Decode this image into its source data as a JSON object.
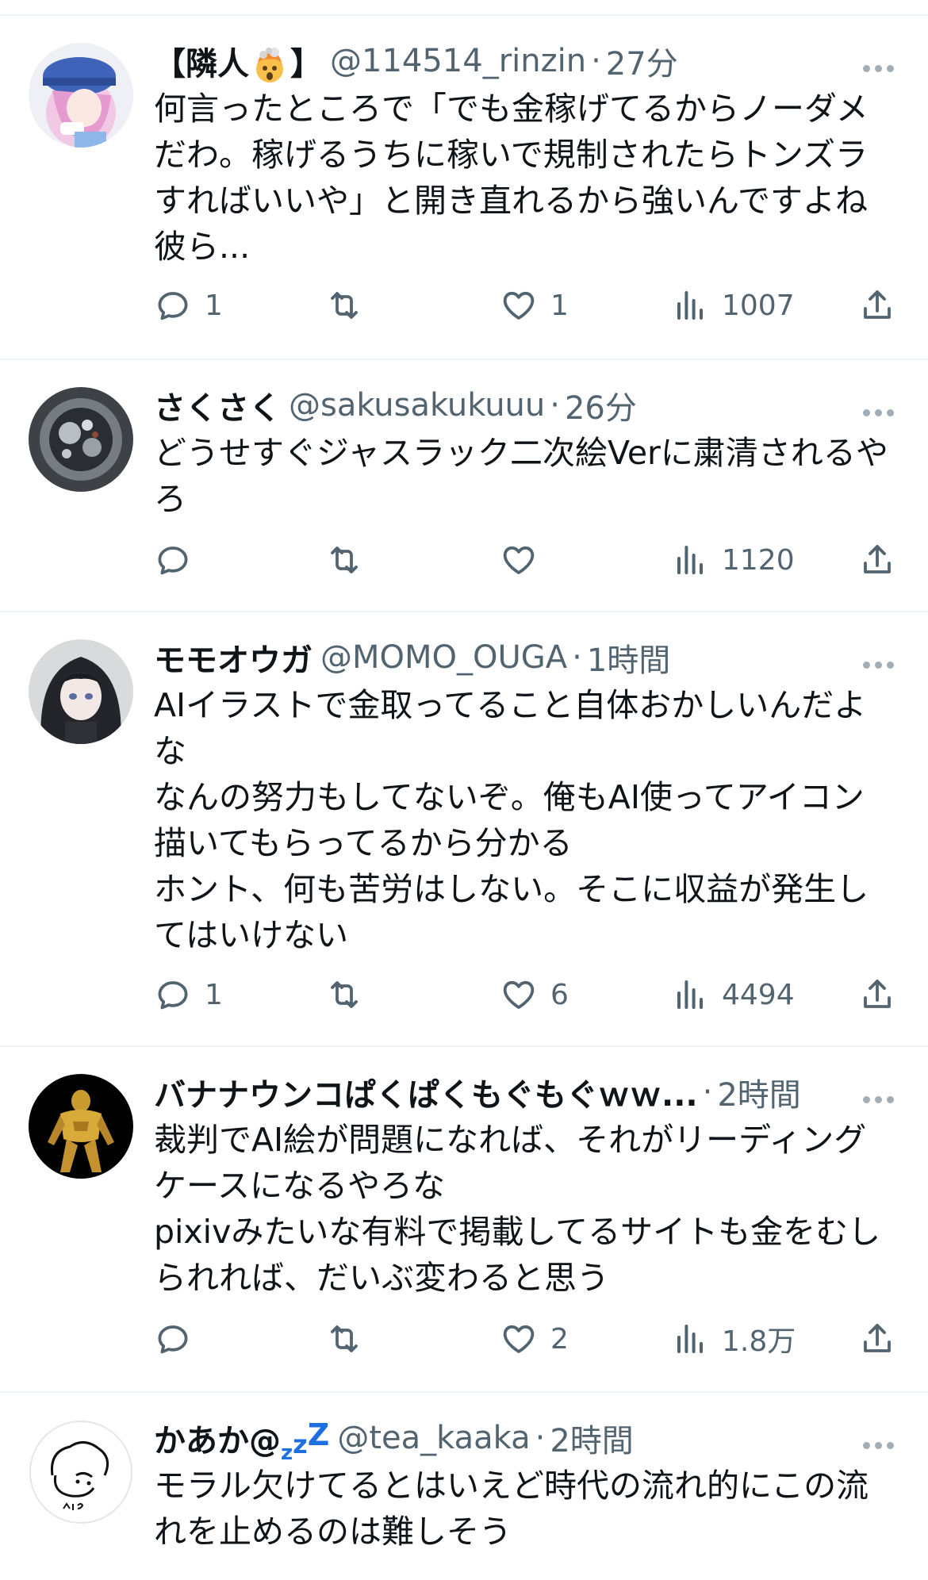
{
  "tweets": [
    {
      "name": "【隣人",
      "name_suffix": "】",
      "name_emoji": "exploding-head-emoji",
      "handle": "@114514_rinzin",
      "sep": "·",
      "time": "27分",
      "text": "何言ったところで「でも金稼げてるからノーダメだわ。稼げるうちに稼いで規制されたらトンズラすればいいや」と開き直れるから強いんですよね彼ら...",
      "replies": "1",
      "retweets": "",
      "likes": "1",
      "views": "1007"
    },
    {
      "name": "さくさく",
      "handle": "@sakusakukuuu",
      "sep": "·",
      "time": "26分",
      "text": "どうせすぐジャスラック二次絵Verに粛清されるやろ",
      "replies": "",
      "retweets": "",
      "likes": "",
      "views": "1120"
    },
    {
      "name": "モモオウガ",
      "handle": "@MOMO_OUGA",
      "sep": "·",
      "time": "1時間",
      "text": "AIイラストで金取ってること自体おかしいんだよな\nなんの努力もしてないぞ。俺もAI使ってアイコン描いてもらってるから分かる\nホント、何も苦労はしない。そこに収益が発生してはいけない",
      "replies": "1",
      "retweets": "",
      "likes": "6",
      "views": "4494"
    },
    {
      "name": "バナナウンコぱくぱくもぐもぐｗｗ...",
      "handle": "",
      "sep": "·",
      "time": "2時間",
      "text": "裁判でAI絵が問題になれば、それがリーディングケースになるやろな\npixivみたいな有料で掲載してるサイトも金をむしられれば、だいぶ変わると思う",
      "replies": "",
      "retweets": "",
      "likes": "2",
      "views": "1.8万"
    },
    {
      "name": "かあか@",
      "name_zzz": "zzZ",
      "handle": "@tea_kaaka",
      "sep": "·",
      "time": "2時間",
      "text": "モラル欠けてるとはいえど時代の流れ的にこの流れを止めるのは難しそう",
      "replies": "",
      "retweets": "",
      "likes": "",
      "views": ""
    }
  ],
  "colors": {
    "text": "#0f1419",
    "secondary": "#536471",
    "divider": "#eff3f4",
    "zzz": "#1d6fe0"
  },
  "icons": [
    "reply-icon",
    "retweet-icon",
    "like-icon",
    "views-icon",
    "share-icon",
    "more-icon"
  ]
}
